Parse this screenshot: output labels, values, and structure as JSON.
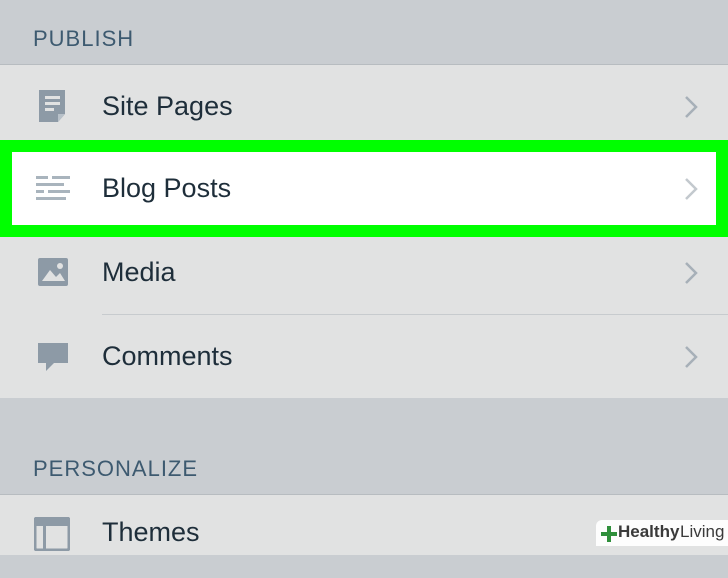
{
  "sections": {
    "publish": {
      "header": "PUBLISH",
      "items": [
        {
          "label": "Site Pages",
          "icon": "page-icon"
        },
        {
          "label": "Blog Posts",
          "icon": "posts-icon",
          "highlighted": true
        },
        {
          "label": "Media",
          "icon": "image-icon"
        },
        {
          "label": "Comments",
          "icon": "comment-icon"
        }
      ]
    },
    "personalize": {
      "header": "PERSONALIZE",
      "items": [
        {
          "label": "Themes",
          "icon": "themes-icon"
        }
      ]
    }
  },
  "watermark": {
    "brand_bold": "Healthy",
    "brand_light": "Living"
  },
  "colors": {
    "highlight": "#00ff00",
    "icon": "#8d9aa6",
    "chevron": "#a7b0b8",
    "header_text": "#3d5a70",
    "label_text": "#1e2e3a"
  }
}
